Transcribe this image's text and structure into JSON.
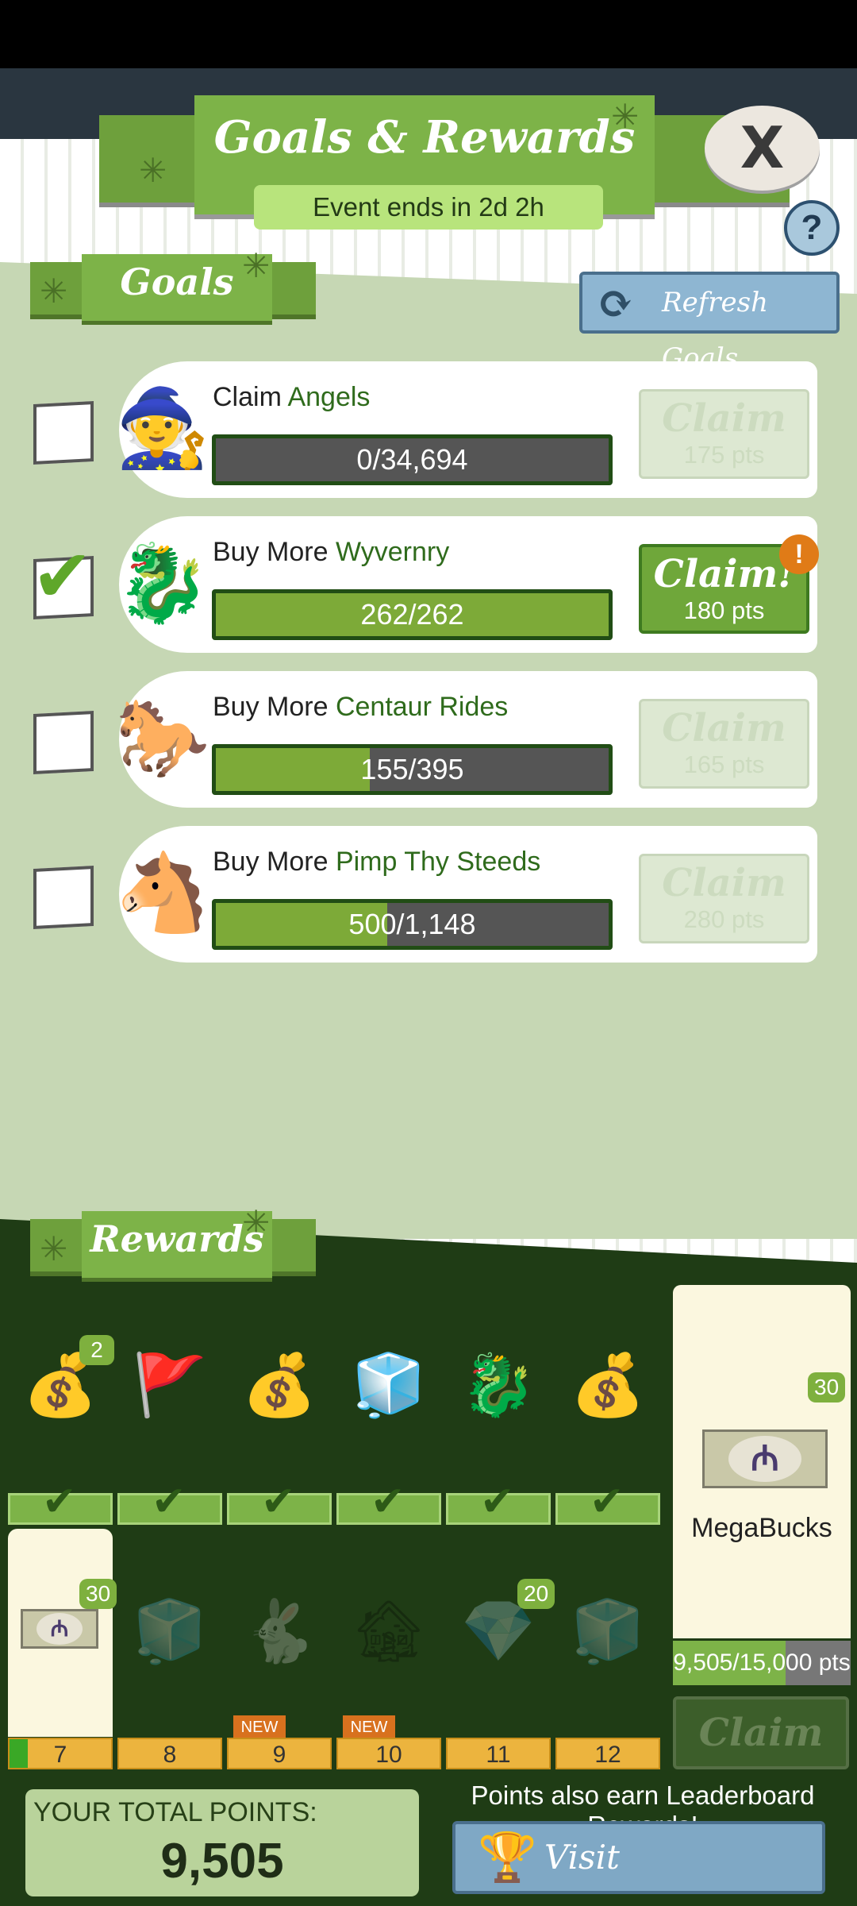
{
  "header": {
    "title": "Goals & Rewards",
    "event_timer": "Event ends in 2d 2h",
    "close_label": "X",
    "help_label": "?"
  },
  "goals_section": {
    "title": "Goals",
    "refresh_label": "Refresh Goals",
    "items": [
      {
        "prefix": "Claim ",
        "target": "Angels",
        "progress_text": "0/34,694",
        "progress": 0.0,
        "claim_label": "Claim",
        "points": "175 pts",
        "completed": false,
        "claimable": false,
        "icon": "wizard-icon"
      },
      {
        "prefix": "Buy More ",
        "target": "Wyvernry",
        "progress_text": "262/262",
        "progress": 1.0,
        "claim_label": "Claim!",
        "points": "180 pts",
        "completed": true,
        "claimable": true,
        "icon": "wyvern-icon"
      },
      {
        "prefix": "Buy More ",
        "target": "Centaur Rides",
        "progress_text": "155/395",
        "progress": 0.392,
        "claim_label": "Claim",
        "points": "165 pts",
        "completed": false,
        "claimable": false,
        "icon": "centaur-icon"
      },
      {
        "prefix": "Buy More ",
        "target": "Pimp Thy Steeds",
        "progress_text": "500/1,148",
        "progress": 0.436,
        "claim_label": "Claim",
        "points": "280 pts",
        "completed": false,
        "claimable": false,
        "icon": "steed-icon"
      }
    ],
    "alert_label": "!"
  },
  "rewards_section": {
    "title": "Rewards",
    "row1": [
      {
        "icon": "gold-pile-icon",
        "badge": "2"
      },
      {
        "icon": "flag-icon",
        "badge": ""
      },
      {
        "icon": "money-bag-purple-icon",
        "badge": ""
      },
      {
        "icon": "crate-icon",
        "badge": ""
      },
      {
        "icon": "wyvern-icon",
        "badge": ""
      },
      {
        "icon": "money-bag-blue-icon",
        "badge": ""
      }
    ],
    "row2": [
      {
        "level": "7",
        "badge": "30",
        "icon": "megabucks-icon",
        "new": ""
      },
      {
        "level": "8",
        "badge": "",
        "icon": "crate-icon",
        "new": ""
      },
      {
        "level": "9",
        "badge": "",
        "icon": "rabbit-statue-icon",
        "new": "NEW"
      },
      {
        "level": "10",
        "badge": "",
        "icon": "building-icon",
        "new": "NEW"
      },
      {
        "level": "11",
        "badge": "20",
        "icon": "gem-pile-icon",
        "new": ""
      },
      {
        "level": "12",
        "badge": "",
        "icon": "crate-icon",
        "new": ""
      }
    ],
    "level7_progress": 0.18,
    "grand_prize": {
      "label": "MegaBucks",
      "badge": "30",
      "coin_symbol": "₼",
      "progress_text": "9,505/15,000 pts",
      "progress": 0.634,
      "claim_label": "Claim"
    }
  },
  "footer": {
    "total_label": "YOUR TOTAL POINTS:",
    "total_value": "9,505",
    "leaderboard_note": "Points also earn Leaderboard Rewards!",
    "leaderboard_button": "Visit Leaderboards"
  },
  "colors": {
    "accent_green": "#7db348",
    "dark_green": "#1f3c15",
    "progress_orange": "#ecb43e",
    "alert_orange": "#e07b17"
  }
}
